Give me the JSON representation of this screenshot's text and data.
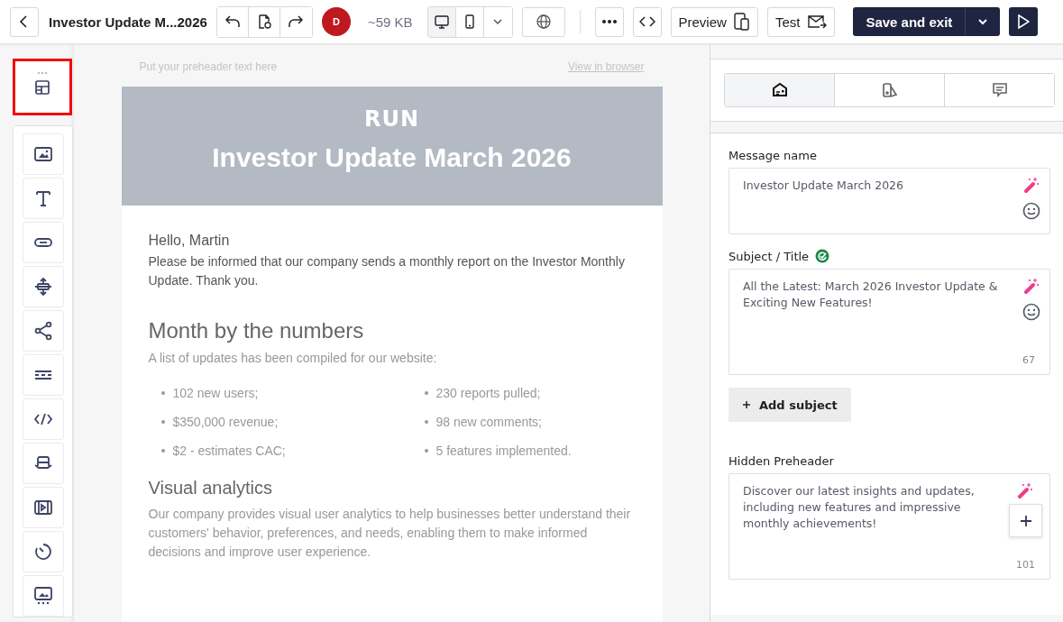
{
  "toolbar": {
    "title": "Investor Update M...2026",
    "avatar": "D",
    "size": "~59 KB",
    "devices": [
      {
        "kind": "desktop",
        "selected": true
      },
      {
        "kind": "mobile",
        "selected": false
      }
    ],
    "preview": "Preview",
    "test": "Test",
    "save": "Save and exit"
  },
  "blocks": {
    "structure_selected": true,
    "tools": [
      {
        "kind": "image"
      },
      {
        "kind": "text"
      },
      {
        "kind": "button"
      },
      {
        "kind": "spacer"
      },
      {
        "kind": "social"
      },
      {
        "kind": "divider"
      },
      {
        "kind": "html"
      },
      {
        "kind": "banner"
      },
      {
        "kind": "video"
      },
      {
        "kind": "timer"
      },
      {
        "kind": "gallery"
      }
    ]
  },
  "email": {
    "preheader": "Put your preheader text here",
    "view_link": "View in browser",
    "logo": "RUN",
    "title": "Investor Update March 2026",
    "greeting": "Hello, Martin",
    "intro": "Please be informed that our company sends a monthly report on the Investor Monthly Update. Thank you.",
    "heading": "Month by the numbers",
    "list_intro": "A list of updates has been compiled for our website:",
    "list_columns": [
      [
        "102 new users;",
        "$350,000 revenue;",
        "$2 - estimates CAC;"
      ],
      [
        "230 reports pulled;",
        "98 new comments;",
        "5 features implemented."
      ]
    ],
    "section_heading": "Visual analytics",
    "section_text": "Our company provides visual user analytics to help businesses better understand their customers' behavior, preferences, and needs, enabling them to make informed decisions and improve user experience."
  },
  "settings": {
    "tabs": [
      {
        "kind": "info",
        "selected": true
      },
      {
        "kind": "style",
        "selected": false
      },
      {
        "kind": "comments",
        "selected": false
      }
    ],
    "fields": [
      {
        "label": "Message name",
        "value": "Investor Update March 2026",
        "verified": false,
        "emoji": true,
        "tall": false
      },
      {
        "label": "Subject / Title",
        "value": "All the Latest: March 2026 Investor Update & Exciting New Features!",
        "verified": true,
        "emoji": true,
        "count": "67",
        "tall": true
      },
      {
        "kind": "add",
        "label": "Add subject"
      },
      {
        "label": "Hidden Preheader",
        "value": "Discover our latest insights and updates, including new features and impressive monthly achievements!",
        "verified": false,
        "emoji": false,
        "count": "101",
        "tall": true
      }
    ]
  }
}
